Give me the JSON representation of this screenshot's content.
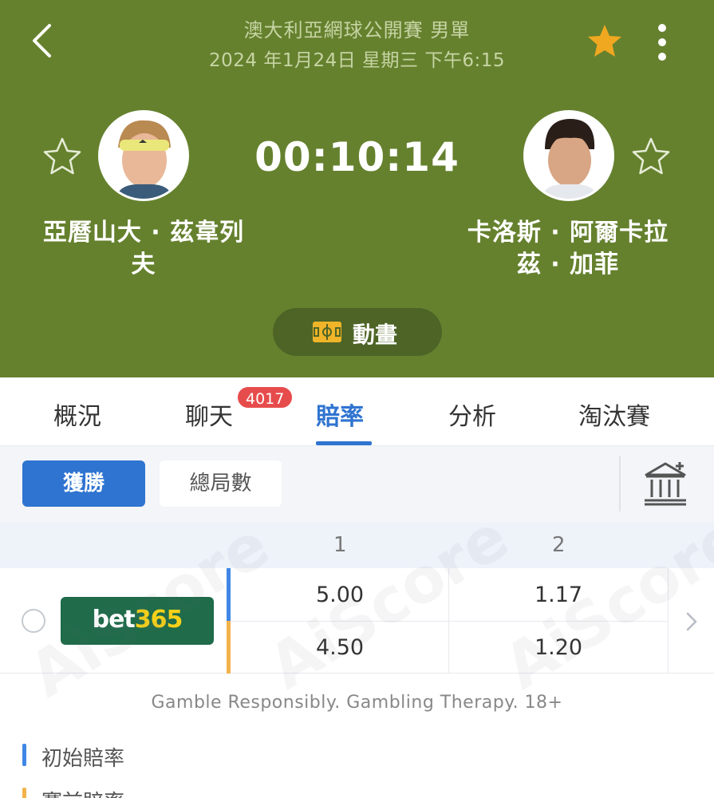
{
  "header": {
    "title": "澳大利亞網球公開賽 男單",
    "datetime": "2024 年1月24日 星期三 下午6:15",
    "timer": "00:10:14",
    "animation_label": "動畫"
  },
  "players": {
    "left": {
      "name_line1": "亞曆山大 · 茲韋列",
      "name_line2": "夫"
    },
    "right": {
      "name_line1": "卡洛斯 · 阿爾卡拉",
      "name_line2": "茲 · 加菲"
    }
  },
  "tabs": [
    {
      "label": "概況"
    },
    {
      "label": "聊天",
      "badge": "4017"
    },
    {
      "label": "賠率",
      "active": true
    },
    {
      "label": "分析"
    },
    {
      "label": "淘汰賽"
    }
  ],
  "filters": {
    "active": "獲勝",
    "other": "總局數"
  },
  "odds": {
    "columns": [
      "1",
      "2"
    ],
    "bookmaker": {
      "part1": "bet",
      "part2": "365"
    },
    "row1": [
      "5.00",
      "1.17"
    ],
    "row2": [
      "4.50",
      "1.20"
    ]
  },
  "watermark": "AiScore",
  "disclaimer": "Gamble Responsibly. Gambling Therapy. 18+",
  "sections": [
    {
      "label": "初始賠率",
      "color": "#3f86e6"
    },
    {
      "label": "賽前賠率",
      "color": "#f3b34b"
    }
  ],
  "colors": {
    "header_bg": "#65812e",
    "accent": "#2f74d0",
    "badge": "#e74c4c",
    "star": "#f0a820"
  },
  "icons": [
    "back-arrow-icon",
    "star-filled-icon",
    "more-vertical-icon",
    "star-outline-icon",
    "pitch-icon",
    "bank-icon",
    "chevron-right-icon"
  ]
}
